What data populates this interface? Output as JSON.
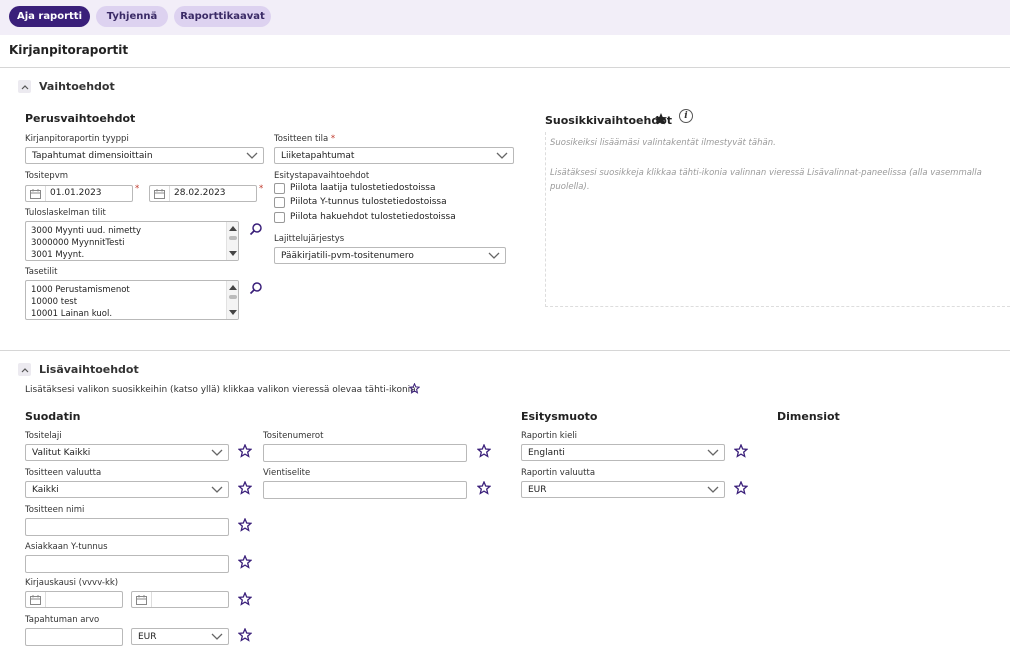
{
  "toolbar": {
    "run_label": "Aja raportti",
    "clear_label": "Tyhjennä",
    "templates_label": "Raporttikaavat"
  },
  "page_title": "Kirjanpitoraportit",
  "options": {
    "section_title": "Vaihtoehdot",
    "basic_title": "Perusvaihtoehdot",
    "report_type_label": "Kirjanpitoraportin tyyppi",
    "report_type_value": "Tapahtumat dimensioittain",
    "voucher_state_label": "Tositteen tila",
    "voucher_state_value": "Liiketapahtumat",
    "voucher_date_label": "Tositepvm",
    "date_from": "01.01.2023",
    "date_to": "28.02.2023",
    "required_mark": "*",
    "presentation_label": "Esitystapavaihtoehdot",
    "checkboxes": [
      "Piilota laatija tulostetiedostoissa",
      "Piilota Y-tunnus tulostetiedostoissa",
      "Piilota hakuehdot tulostetiedostoissa"
    ],
    "income_accounts_label": "Tuloslaskelman tilit",
    "income_accounts": [
      "3000 Myynti uud. nimetty",
      "3000000 MyynnitTesti",
      "3001 Myynt."
    ],
    "sort_label": "Lajittelujärjestys",
    "sort_value": "Pääkirjatili-pvm-tositenumero",
    "balance_accounts_label": "Tasetilit",
    "balance_accounts": [
      "1000 Perustamismenot",
      "10000 test",
      "10001 Lainan kuol."
    ]
  },
  "favorites": {
    "title": "Suosikkivaihtoehdot",
    "info_glyph": "i",
    "hint1": "Suosikeiksi lisäämäsi valintakentät ilmestyvät tähän.",
    "hint2": "Lisätäksesi suosikkeja klikkaa tähti-ikonia valinnan vieressä Lisävalinnat-paneelissa (alla vasemmalla puolella)."
  },
  "additional": {
    "section_title": "Lisävaihtoehdot",
    "description": "Lisätäksesi valikon suosikkeihin (katso yllä) klikkaa valikon vieressä olevaa tähti-ikonia.",
    "filter_title": "Suodatin",
    "presentation_title": "Esitysmuoto",
    "dimensions_title": "Dimensiot",
    "voucher_type_label": "Tositelaji",
    "voucher_type_value": "Valitut Kaikki",
    "voucher_numbers_label": "Tositenumerot",
    "currency_label": "Tositteen valuutta",
    "currency_value": "Kaikki",
    "entry_desc_label": "Vientiselite",
    "voucher_name_label": "Tositteen nimi",
    "customer_id_label": "Asiakkaan Y-tunnus",
    "period_label": "Kirjauskausi (vvvv-kk)",
    "amount_label": "Tapahtuman arvo",
    "amount_currency": "EUR",
    "report_language_label": "Raportin kieli",
    "report_language_value": "Englanti",
    "report_currency_label": "Raportin valuutta",
    "report_currency_value": "EUR"
  },
  "icons": {
    "accent": "#3a1f7a",
    "star": "star-outline-icon",
    "calendar": "calendar-icon",
    "search": "search-icon",
    "chevron": "chevron-down-icon"
  }
}
